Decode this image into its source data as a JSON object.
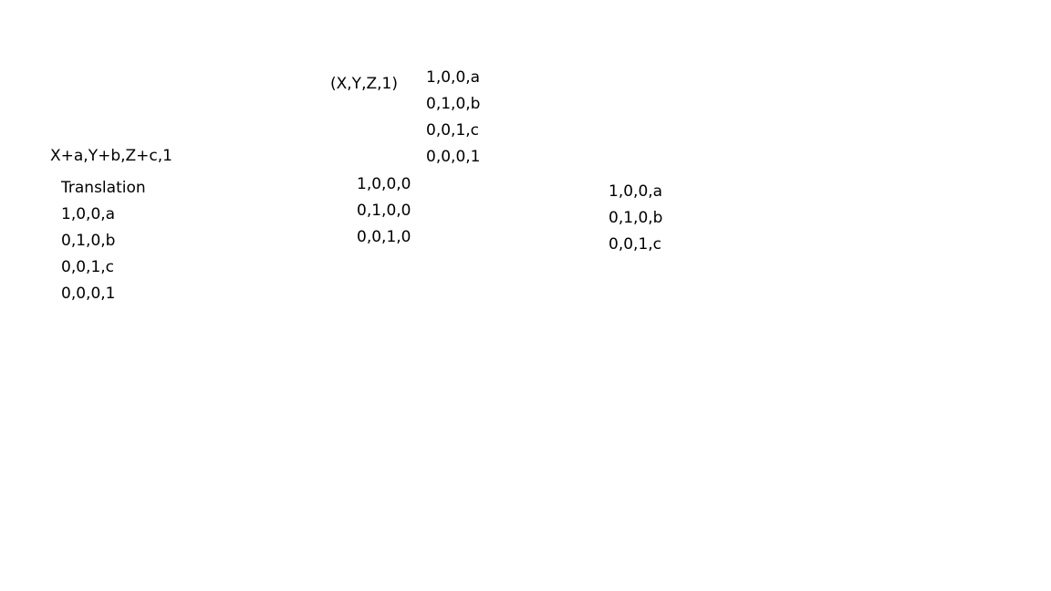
{
  "vector": "(X,Y,Z,1)",
  "result": "X+a,Y+b,Z+c,1",
  "matrix_top": [
    "1,0,0,a",
    "0,1,0,b",
    "0,0,1,c",
    "0,0,0,1"
  ],
  "translation": {
    "label": "Translation",
    "rows": [
      "1,0,0,a",
      "0,1,0,b",
      "0,0,1,c",
      "0,0,0,1"
    ]
  },
  "matrix_middle": [
    "1,0,0,0",
    "0,1,0,0",
    "0,0,1,0"
  ],
  "matrix_right": [
    "1,0,0,a",
    "0,1,0,b",
    "0,0,1,c"
  ]
}
